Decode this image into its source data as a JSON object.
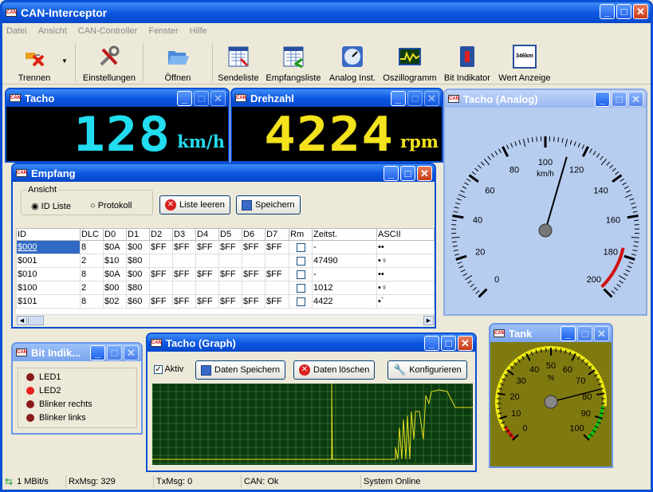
{
  "app": {
    "title": "CAN-Interceptor"
  },
  "menu": [
    "Datei",
    "Ansicht",
    "CAN-Controller",
    "Fenster",
    "Hilfe"
  ],
  "toolbar": [
    {
      "label": "Trennen",
      "icon": "disconnect-icon"
    },
    {
      "label": "Einstellungen",
      "icon": "tools-icon"
    },
    {
      "label": "Öffnen",
      "icon": "open-folder-icon"
    },
    {
      "label": "Sendeliste",
      "icon": "send-list-icon"
    },
    {
      "label": "Empfangsliste",
      "icon": "receive-list-icon"
    },
    {
      "label": "Analog Inst.",
      "icon": "gauge-icon"
    },
    {
      "label": "Oszillogramm",
      "icon": "oscilloscope-icon"
    },
    {
      "label": "Bit Indikator",
      "icon": "bit-indicator-icon"
    },
    {
      "label": "Wert Anzeige",
      "icon": "value-display-icon",
      "icon_text": "346km"
    }
  ],
  "tacho": {
    "title": "Tacho",
    "value": "128",
    "unit": "km/h",
    "color": "#22dcef"
  },
  "drehzahl": {
    "title": "Drehzahl",
    "value": "4224",
    "unit": "rpm",
    "color": "#f3e21c"
  },
  "tacho_analog": {
    "title": "Tacho (Analog)",
    "unit": "km/h",
    "ticks": [
      "0",
      "20",
      "40",
      "60",
      "80",
      "100",
      "120",
      "140",
      "160",
      "180",
      "200"
    ],
    "value": 112
  },
  "empfang": {
    "title": "Empfang",
    "group_label": "Ansicht",
    "radio_id": "ID Liste",
    "radio_protokoll": "Protokoll",
    "btn_clear": "Liste leeren",
    "btn_save": "Speichern",
    "columns": [
      "ID",
      "DLC",
      "D0",
      "D1",
      "D2",
      "D3",
      "D4",
      "D5",
      "D6",
      "D7",
      "Rm",
      "Zeitst.",
      "ASCII"
    ],
    "rows": [
      [
        "$000",
        "8",
        "$0A",
        "$00",
        "$FF",
        "$FF",
        "$FF",
        "$FF",
        "$FF",
        "$FF",
        "",
        "-",
        "••"
      ],
      [
        "$001",
        "2",
        "$10",
        "$80",
        "",
        "",
        "",
        "",
        "",
        "",
        "",
        "47490",
        "•♀"
      ],
      [
        "$010",
        "8",
        "$0A",
        "$00",
        "$FF",
        "$FF",
        "$FF",
        "$FF",
        "$FF",
        "$FF",
        "",
        "-",
        "••"
      ],
      [
        "$100",
        "2",
        "$00",
        "$80",
        "",
        "",
        "",
        "",
        "",
        "",
        "",
        "1012",
        "•♀"
      ],
      [
        "$101",
        "8",
        "$02",
        "$60",
        "$FF",
        "$FF",
        "$FF",
        "$FF",
        "$FF",
        "$FF",
        "",
        "4422",
        "•`"
      ]
    ]
  },
  "bit": {
    "title": "Bit Indik...",
    "items": [
      {
        "label": "LED1",
        "color": "#8b1a1a"
      },
      {
        "label": "LED2",
        "color": "#e82020"
      },
      {
        "label": "Blinker rechts",
        "color": "#8b1a1a"
      },
      {
        "label": "Blinker links",
        "color": "#8b1a1a"
      }
    ]
  },
  "graph": {
    "title": "Tacho (Graph)",
    "check": "Aktiv",
    "btn_save": "Daten Speichern",
    "btn_delete": "Daten löschen",
    "btn_config": "Konfigurieren"
  },
  "tank": {
    "title": "Tank",
    "unit": "%",
    "ticks": [
      "0",
      "10",
      "20",
      "30",
      "40",
      "50",
      "60",
      "70",
      "80",
      "90",
      "100"
    ],
    "value": 78
  },
  "status": {
    "speed": "1 MBit/s",
    "rx": "RxMsg: 329",
    "tx": "TxMsg: 0",
    "can": "CAN: Ok",
    "sys": "System Online"
  }
}
